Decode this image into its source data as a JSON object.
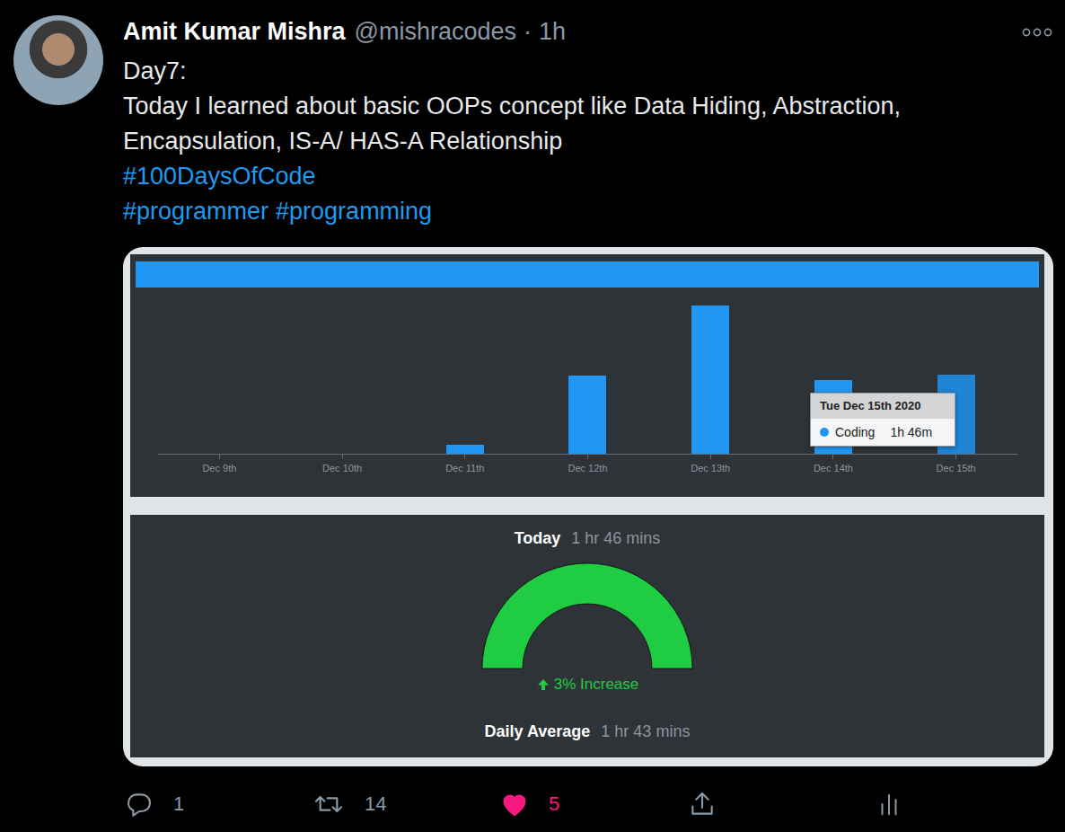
{
  "author": {
    "name": "Amit Kumar Mishra",
    "handle": "@mishracodes",
    "separator": "·",
    "time": "1h"
  },
  "tweet": {
    "lines": [
      "Day7:",
      "Today I learned about basic OOPs concept like Data Hiding, Abstraction,",
      "Encapsulation, IS-A/ HAS-A Relationship"
    ],
    "hashtag_lines": [
      [
        "#100DaysOfCode"
      ],
      [
        "#programmer",
        "#programming"
      ]
    ]
  },
  "chart": {
    "x_ticks": [
      "Dec 9th",
      "Dec 10th",
      "Dec 11th",
      "Dec 12th",
      "Dec 13th",
      "Dec 14th",
      "Dec 15th"
    ],
    "series": [
      {
        "name": "Coding",
        "color": "#2196f3",
        "values": [
          0,
          0,
          0.2,
          1.74,
          3.3,
          1.64,
          1.77
        ]
      }
    ],
    "tooltip": {
      "title": "Tue Dec 15th 2020",
      "series": "Coding",
      "value": "1h 46m",
      "bar": 6
    }
  },
  "summary": {
    "today_label": "Today",
    "today_value": "1 hr 46 mins",
    "gauge": {
      "level": 1
    },
    "change": "3% Increase",
    "average_label": "Daily Average",
    "average_value": "1 hr 43 mins"
  },
  "actions": [
    {
      "kind": "reply",
      "count": "1",
      "active": false
    },
    {
      "kind": "retweet",
      "count": "14",
      "active": false
    },
    {
      "kind": "like",
      "count": "5",
      "active": true
    },
    {
      "kind": "share",
      "active": false
    },
    {
      "kind": "analytics",
      "active": false
    }
  ]
}
